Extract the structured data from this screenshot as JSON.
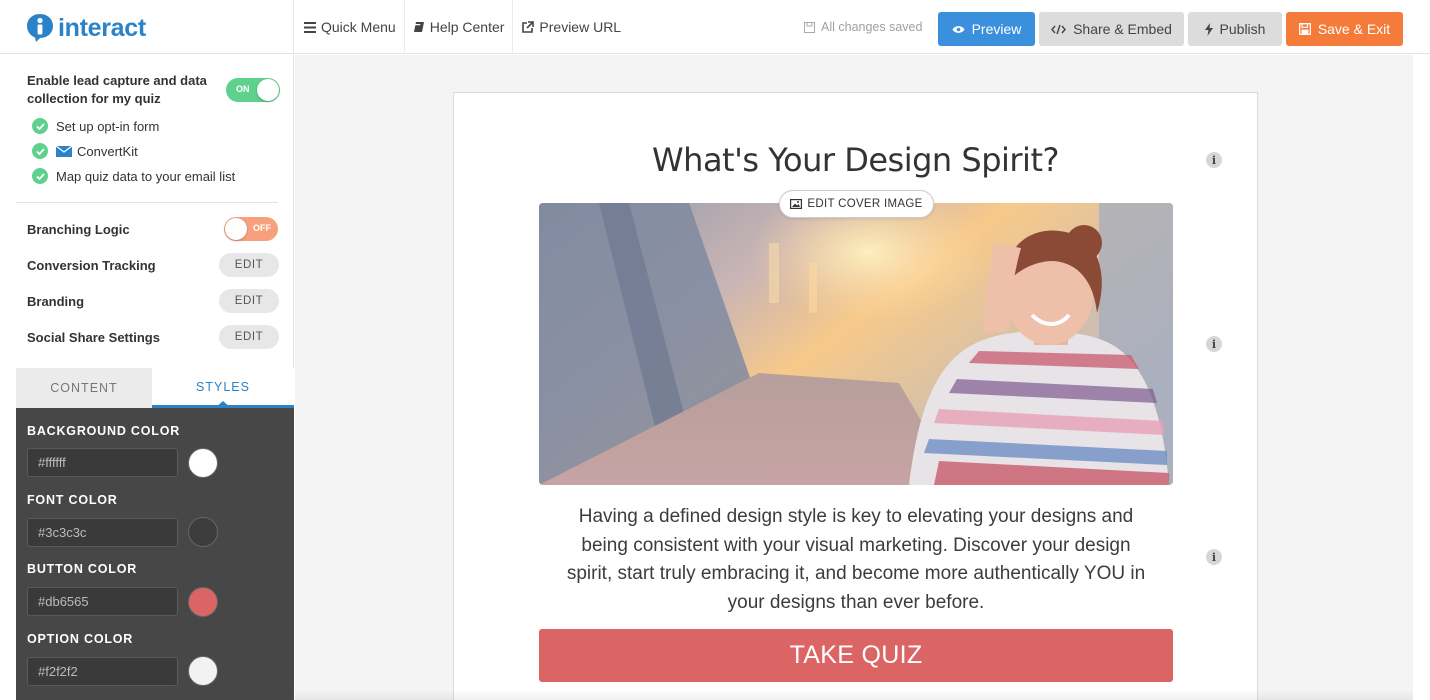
{
  "app": {
    "logo_text": "interact"
  },
  "topnav": {
    "quick_menu": "Quick Menu",
    "help_center": "Help Center",
    "preview_url": "Preview URL"
  },
  "status": {
    "saved": "All changes saved"
  },
  "actions": {
    "preview": "Preview",
    "share_embed": "Share & Embed",
    "publish": "Publish",
    "save_exit": "Save & Exit"
  },
  "sidebar": {
    "lead_capture": {
      "label": "Enable lead capture and data collection for my quiz",
      "toggle_label": "ON",
      "enabled": true,
      "steps": [
        "Set up opt-in form",
        "ConvertKit",
        "Map quiz data to your email list"
      ]
    },
    "branching": {
      "label": "Branching Logic",
      "toggle_label": "OFF",
      "enabled": false
    },
    "settings": [
      {
        "label": "Conversion Tracking",
        "button": "EDIT"
      },
      {
        "label": "Branding",
        "button": "EDIT"
      },
      {
        "label": "Social Share Settings",
        "button": "EDIT"
      }
    ],
    "tabs": {
      "content": "CONTENT",
      "styles": "STYLES",
      "active": "styles"
    },
    "styles": [
      {
        "label": "BACKGROUND COLOR",
        "value": "#ffffff",
        "swatch": "#ffffff"
      },
      {
        "label": "FONT COLOR",
        "value": "#3c3c3c",
        "swatch": "#3c3c3c"
      },
      {
        "label": "BUTTON COLOR",
        "value": "#db6565",
        "swatch": "#db6565"
      },
      {
        "label": "OPTION COLOR",
        "value": "#f2f2f2",
        "swatch": "#f2f2f2"
      }
    ]
  },
  "quiz": {
    "title": "What's Your Design Spirit?",
    "edit_cover": "EDIT COVER IMAGE",
    "description": "Having a defined design style is key to elevating your designs and being consistent with your visual marketing. Discover your design spirit, start truly embracing it, and become more authentically YOU in your designs than ever before.",
    "cta": "TAKE QUIZ",
    "info_glyph": "i"
  },
  "colors": {
    "brand": "#2a83c9",
    "preview": "#3a90dd",
    "save": "#f47b3a",
    "toggle_on": "#5fd18c",
    "toggle_off": "#f8a07d"
  }
}
